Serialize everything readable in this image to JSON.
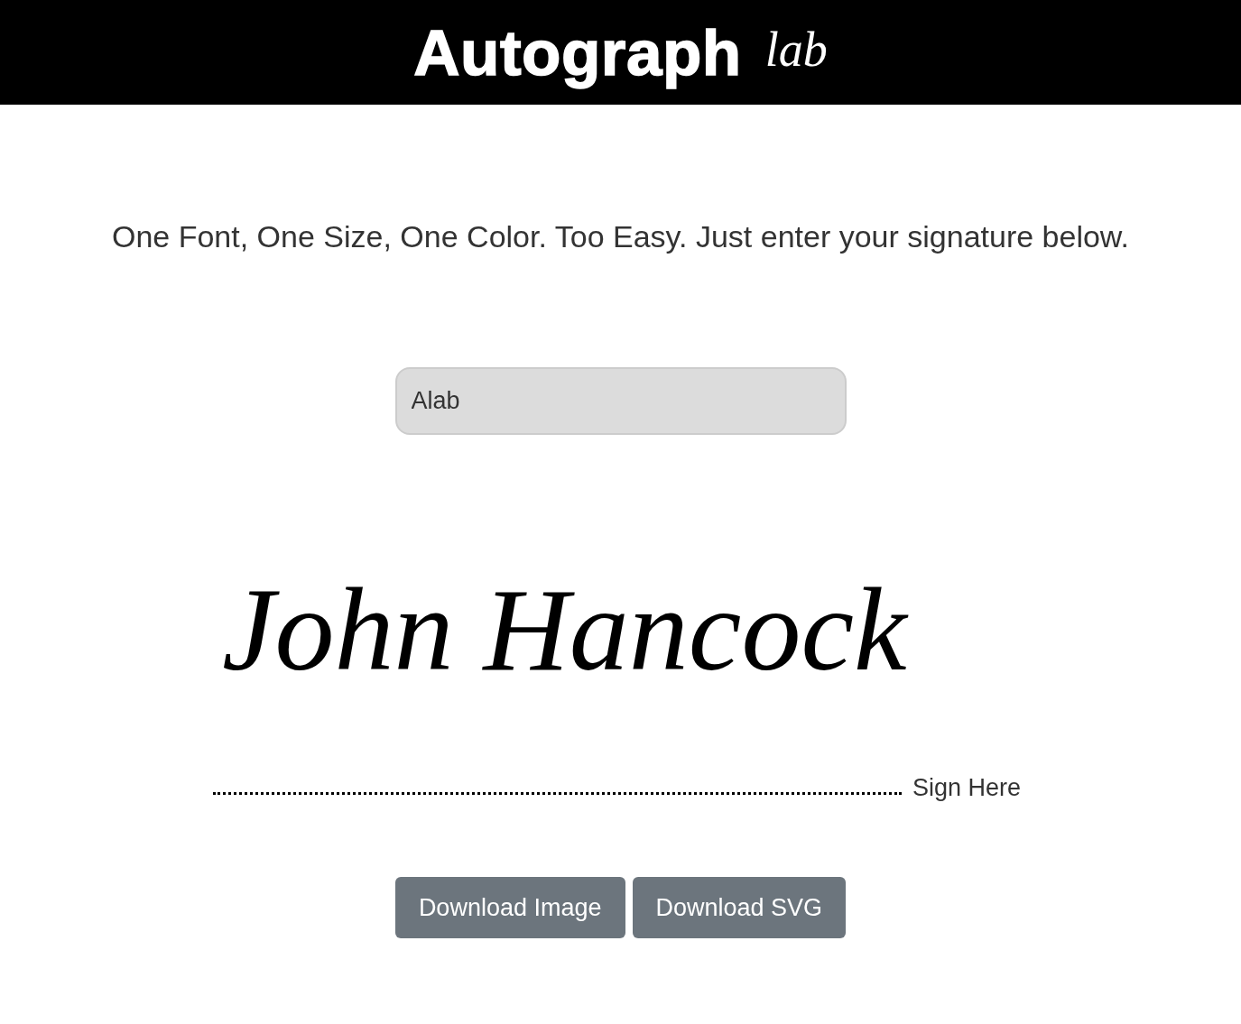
{
  "header": {
    "title": "Autograph",
    "subtitle": "lab"
  },
  "tagline": "One Font, One Size, One Color. Too Easy. Just enter your signature below.",
  "signature_input": {
    "value": "Alab"
  },
  "signature": {
    "text": "John Hancock",
    "line_label": "Sign Here"
  },
  "buttons": [
    {
      "label": "Download Image"
    },
    {
      "label": "Download SVG"
    }
  ]
}
